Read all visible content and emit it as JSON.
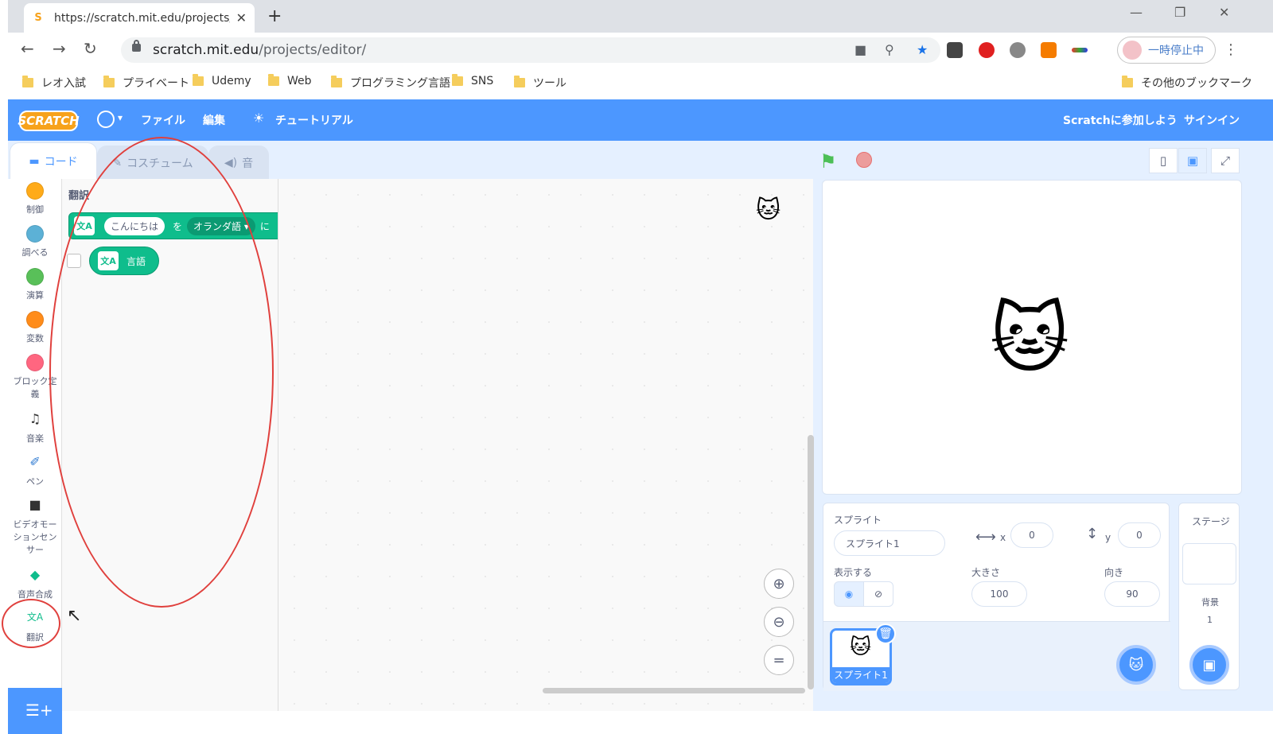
{
  "browser": {
    "tab_title": "https://scratch.mit.edu/projects/e",
    "url_host": "scratch.mit.edu",
    "url_path": "/projects/editor/",
    "profile_label": "一時停止中",
    "bookmarks": [
      "レオ入試",
      "プライベート",
      "Udemy",
      "Web",
      "プログラミング言語",
      "SNS",
      "ツール"
    ],
    "other_bookmarks": "その他のブックマーク"
  },
  "header": {
    "logo": "SCRATCH",
    "file": "ファイル",
    "edit": "編集",
    "tutorial": "チュートリアル",
    "join": "Scratchに参加しよう",
    "signin": "サインイン"
  },
  "tabs": {
    "code": "コード",
    "costumes": "コスチューム",
    "sounds": "音"
  },
  "categories": [
    {
      "label": "制御",
      "color": "#ffab19"
    },
    {
      "label": "調べる",
      "color": "#5cb1d6"
    },
    {
      "label": "演算",
      "color": "#59c059"
    },
    {
      "label": "変数",
      "color": "#ff8c1a"
    },
    {
      "label": "ブロック定義",
      "color": "#ff6680"
    },
    {
      "label": "音楽"
    },
    {
      "label": "ペン"
    },
    {
      "label": "ビデオモーションセンサー"
    },
    {
      "label": "音声合成"
    },
    {
      "label": "翻訳"
    }
  ],
  "palette": {
    "title": "翻訳",
    "block_input": "こんにちは",
    "block_wo": "を",
    "block_lang": "オランダ語",
    "block_ni": "に",
    "reporter": "言語"
  },
  "sprite_info": {
    "sprite_label": "スプライト",
    "sprite_name": "スプライト1",
    "x_label": "x",
    "x": "0",
    "y_label": "y",
    "y": "0",
    "show_label": "表示する",
    "size_label": "大きさ",
    "size": "100",
    "direction_label": "向き",
    "direction": "90",
    "thumb_name": "スプライト1"
  },
  "stage_panel": {
    "title": "ステージ",
    "backdrop_label": "背景",
    "backdrop_count": "1"
  }
}
